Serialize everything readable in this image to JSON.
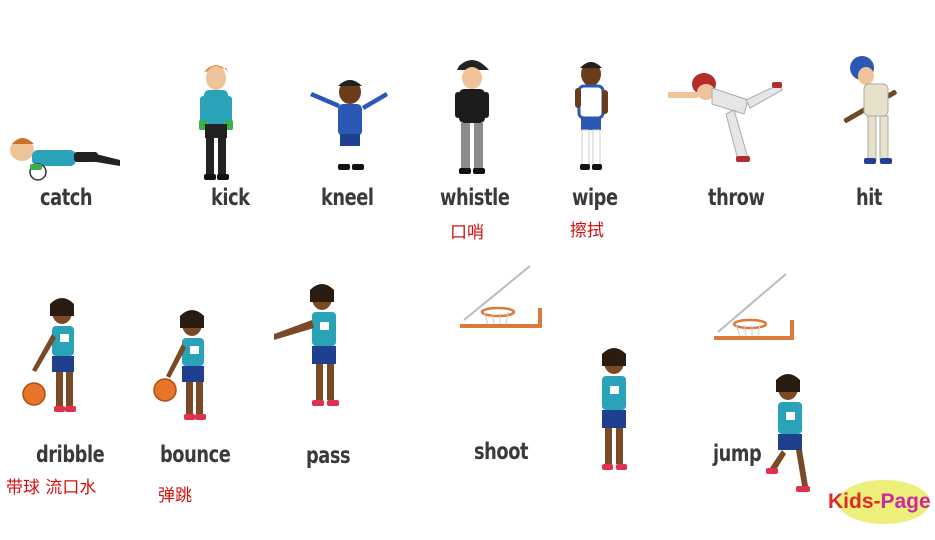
{
  "words": {
    "catch": "catch",
    "kick": "kick",
    "kneel": "kneel",
    "whistle": "whistle",
    "wipe": "wipe",
    "throw": "throw",
    "hit": "hit",
    "dribble": "dribble",
    "bounce": "bounce",
    "pass": "pass",
    "shoot": "shoot",
    "jump": "jump"
  },
  "notes": {
    "whistle": "口哨",
    "wipe": "擦拭",
    "dribble": "带球 流口水",
    "bounce": "弹跳"
  },
  "logo": {
    "part1": "Kids-",
    "part2": "Page"
  },
  "colors": {
    "word": "#3a3a3a",
    "note": "#d21010",
    "jersey": "#2aa3b8",
    "shorts": "#1f3f8f",
    "ball": "#e8742a",
    "hoop": "#d9793a"
  }
}
